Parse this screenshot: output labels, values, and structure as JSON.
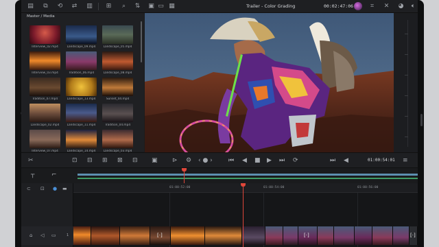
{
  "app": {
    "title": "Trailer - Color Grading",
    "timecode": "00:02:47:06"
  },
  "media_pool": {
    "title": "Master / Media",
    "clips": [
      {
        "name": "Interview_02.mp4"
      },
      {
        "name": "Landscape_09.mp4"
      },
      {
        "name": "Landscape_05.mp4"
      },
      {
        "name": "Interview_03.mp4"
      },
      {
        "name": "Tradition_06.mp4"
      },
      {
        "name": "Landscape_08.mp4"
      },
      {
        "name": "Tradition_07.mp4"
      },
      {
        "name": "Landscape_13.mp4"
      },
      {
        "name": "Sunset_04.mp4"
      },
      {
        "name": "Landscape_02.mp4"
      },
      {
        "name": "Landscape_11.mp4"
      },
      {
        "name": "Tradition_04.mp4"
      },
      {
        "name": "Interview_07.mp4"
      },
      {
        "name": "Landscape_14.mp4"
      },
      {
        "name": "Landscape_03.mp4"
      }
    ]
  },
  "transport": {
    "timecode": "01:00:54:01"
  },
  "timeline": {
    "ruler": [
      "01:00:52:00",
      "01:00:54:00",
      "01:00:56:00"
    ],
    "track_number": "1"
  },
  "colors": {
    "playhead": "#e0473a",
    "video_track": "#5d8fb0",
    "audio_track": "#3f9b64"
  }
}
